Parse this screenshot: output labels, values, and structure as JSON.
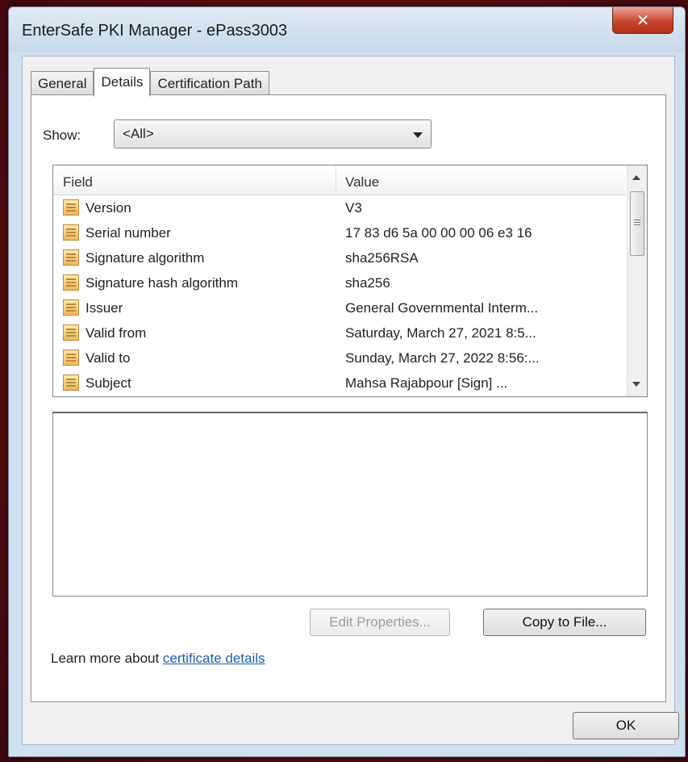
{
  "window": {
    "title": "EnterSafe PKI Manager - ePass3003",
    "close_glyph": "✕"
  },
  "tabs": [
    {
      "label": "General",
      "active": false
    },
    {
      "label": "Details",
      "active": true
    },
    {
      "label": "Certification Path",
      "active": false
    }
  ],
  "show": {
    "label": "Show:",
    "selected": "<All>"
  },
  "list": {
    "headers": {
      "field": "Field",
      "value": "Value"
    },
    "rows": [
      {
        "field": "Version",
        "value": "V3"
      },
      {
        "field": "Serial number",
        "value": "17 83 d6 5a 00 00 00 06 e3 16"
      },
      {
        "field": "Signature algorithm",
        "value": "sha256RSA"
      },
      {
        "field": "Signature hash algorithm",
        "value": "sha256"
      },
      {
        "field": "Issuer",
        "value": "General Governmental Interm..."
      },
      {
        "field": "Valid from",
        "value": "Saturday, March 27, 2021 8:5..."
      },
      {
        "field": "Valid to",
        "value": "Sunday, March 27, 2022 8:56:..."
      },
      {
        "field": "Subject",
        "value": "Mahsa Rajabpour [Sign] ..."
      }
    ]
  },
  "buttons": {
    "edit_properties": "Edit Properties...",
    "copy_to_file": "Copy to File...",
    "ok": "OK"
  },
  "learn_more": {
    "prefix": "Learn more about ",
    "link": "certificate details"
  }
}
